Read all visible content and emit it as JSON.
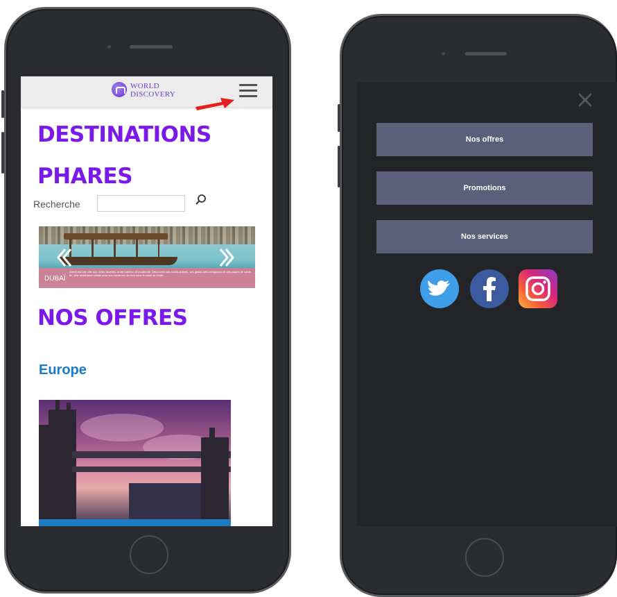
{
  "left_screen": {
    "logo_text_line1": "WORLD",
    "logo_text_line2": "DISCOVERY",
    "headline_line1": "DESTINATIONS",
    "headline_line2": "PHARES",
    "search": {
      "label": "Recherche",
      "value": "",
      "placeholder": ""
    },
    "slider": {
      "caption_title": "DUBAÏ",
      "caption_text": "Dubaï est une ville aux milles facettes, entre tradition et modernité. Découvrez ses souks animés, ses gratte-ciels vertigineux et ses plages de sable fin. Une destination idéale pour vos vacances de rêve sous le soleil du Golfe."
    },
    "offers_heading": "NOS OFFRES",
    "region_label": "Europe"
  },
  "right_screen": {
    "menu_items": [
      {
        "label": "Nos offres"
      },
      {
        "label": "Promotions"
      },
      {
        "label": "Nos services"
      }
    ],
    "social_icons": [
      "twitter-icon",
      "facebook-icon",
      "instagram-icon"
    ]
  },
  "colors": {
    "headline_purple": "#7b18ea",
    "region_blue": "#1a79c9",
    "menu_button": "#5b5f7a",
    "menu_bg": "#242528",
    "annotation_arrow": "#e61e1e"
  }
}
